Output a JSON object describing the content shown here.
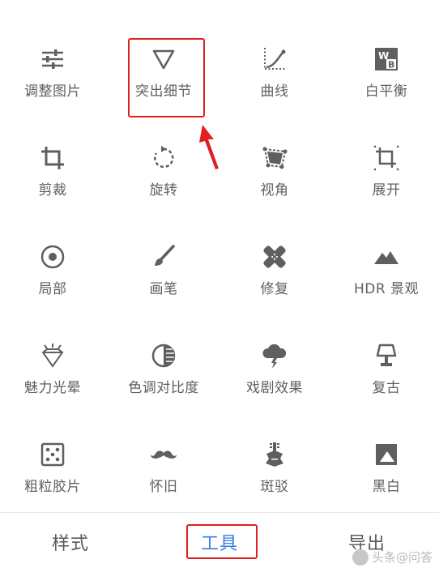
{
  "tools": [
    {
      "name": "tool-tune-image",
      "label": "调整图片",
      "icon": "sliders-icon"
    },
    {
      "name": "tool-details",
      "label": "突出细节",
      "icon": "triangle-icon"
    },
    {
      "name": "tool-curves",
      "label": "曲线",
      "icon": "curve-icon"
    },
    {
      "name": "tool-white-balance",
      "label": "白平衡",
      "icon": "wb-icon"
    },
    {
      "name": "tool-crop",
      "label": "剪裁",
      "icon": "crop-icon"
    },
    {
      "name": "tool-rotate",
      "label": "旋转",
      "icon": "rotate-icon"
    },
    {
      "name": "tool-perspective",
      "label": "视角",
      "icon": "perspective-icon"
    },
    {
      "name": "tool-expand",
      "label": "展开",
      "icon": "expand-icon"
    },
    {
      "name": "tool-selective",
      "label": "局部",
      "icon": "target-icon"
    },
    {
      "name": "tool-brush",
      "label": "画笔",
      "icon": "brush-icon"
    },
    {
      "name": "tool-healing",
      "label": "修复",
      "icon": "bandage-icon"
    },
    {
      "name": "tool-hdr",
      "label": "HDR 景观",
      "icon": "mountain-icon"
    },
    {
      "name": "tool-glamour-glow",
      "label": "魅力光晕",
      "icon": "diamond-icon"
    },
    {
      "name": "tool-tonal-contrast",
      "label": "色调对比度",
      "icon": "contrast-icon"
    },
    {
      "name": "tool-drama",
      "label": "戏剧效果",
      "icon": "storm-cloud-icon"
    },
    {
      "name": "tool-vintage",
      "label": "复古",
      "icon": "lamp-icon"
    },
    {
      "name": "tool-grainy-film",
      "label": "粗粒胶片",
      "icon": "dice-icon"
    },
    {
      "name": "tool-retrolux",
      "label": "怀旧",
      "icon": "mustache-icon"
    },
    {
      "name": "tool-grunge",
      "label": "斑驳",
      "icon": "guitar-icon"
    },
    {
      "name": "tool-black-white",
      "label": "黑白",
      "icon": "bw-photo-icon"
    }
  ],
  "tabs": {
    "styles": "样式",
    "tools": "工具",
    "export": "导出"
  },
  "watermark": "头条@问答",
  "colors": {
    "icon": "#5f5f5f",
    "accent": "#3a7ae8",
    "annotation": "#e02020"
  }
}
